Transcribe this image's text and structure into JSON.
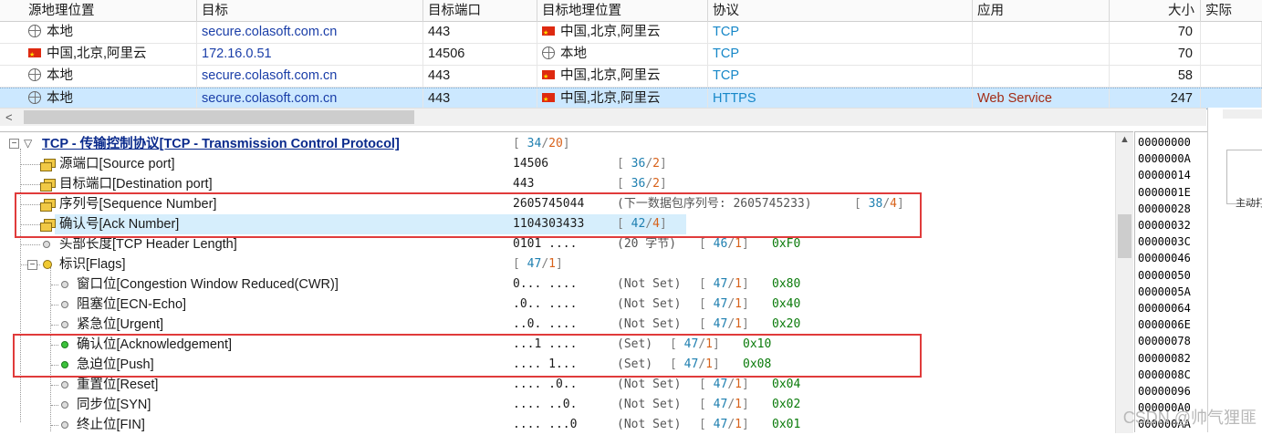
{
  "columns": [
    "源地理位置",
    "目标",
    "目标端口",
    "目标地理位置",
    "协议",
    "应用",
    "大小",
    "实际"
  ],
  "rows": [
    {
      "src_icon": "globe-icon",
      "src": "本地",
      "dst": "secure.colasoft.com.cn",
      "port": "443",
      "dgeo_icon": "china-flag-icon",
      "dgeo": "中国,北京,阿里云",
      "proto": "TCP",
      "app": "",
      "size": "70",
      "selected": false
    },
    {
      "src_icon": "china-flag-icon",
      "src": "中国,北京,阿里云",
      "dst": "172.16.0.51",
      "port": "14506",
      "dgeo_icon": "globe-icon",
      "dgeo": "本地",
      "proto": "TCP",
      "app": "",
      "size": "70",
      "selected": false
    },
    {
      "src_icon": "globe-icon",
      "src": "本地",
      "dst": "secure.colasoft.com.cn",
      "port": "443",
      "dgeo_icon": "china-flag-icon",
      "dgeo": "中国,北京,阿里云",
      "proto": "TCP",
      "app": "",
      "size": "58",
      "selected": false
    },
    {
      "src_icon": "globe-icon",
      "src": "本地",
      "dst": "secure.colasoft.com.cn",
      "port": "443",
      "dgeo_icon": "china-flag-icon",
      "dgeo": "中国,北京,阿里云",
      "proto": "HTTPS",
      "app": "Web Service",
      "size": "247",
      "selected": true
    }
  ],
  "scroll_left_arrow": "<",
  "tree": {
    "root": {
      "label": "TCP - 传输控制协议[TCP - Transmission Control Protocol]",
      "o1": "34",
      "o2": "20"
    },
    "lines": [
      {
        "key": "src-port",
        "label": "源端口[Source port]",
        "value": "14506",
        "note": "",
        "o1": "36",
        "o2": "2",
        "hex": "",
        "pre": "[ ",
        "mid": "/",
        "post": "]",
        "icon": "field"
      },
      {
        "key": "dst-port",
        "label": "目标端口[Destination port]",
        "value": "443",
        "note": "",
        "o1": "36",
        "o2": "2",
        "hex": "",
        "icon": "field"
      },
      {
        "key": "seq",
        "label": "序列号[Sequence Number]",
        "value": "2605745044",
        "note": "(下一数据包序列号: 2605745233)",
        "o1": "38",
        "o2": "4",
        "hex": "",
        "icon": "field"
      },
      {
        "key": "ack",
        "label": "确认号[Ack Number]",
        "value": "1104303433",
        "note": "",
        "o1": "42",
        "o2": "4",
        "hex": "",
        "icon": "field"
      },
      {
        "key": "hdr-len",
        "label": "头部长度[TCP Header Length]",
        "value": "0101 ....",
        "note": "(20 字节)",
        "o1": "46",
        "o2": "1",
        "hex": "0xF0",
        "icon": "dot"
      },
      {
        "key": "flags",
        "label": "标识[Flags]",
        "value": "",
        "note": "",
        "o1": "47",
        "o2": "1",
        "hex": "",
        "icon": "flags"
      },
      {
        "key": "cwr",
        "label": "窗口位[Congestion Window Reduced(CWR)]",
        "value": "0... ....",
        "note": "(Not Set)",
        "o1": "47",
        "o2": "1",
        "hex": "0x80",
        "icon": "dot"
      },
      {
        "key": "ece",
        "label": "阻塞位[ECN-Echo]",
        "value": ".0.. ....",
        "note": "(Not Set)",
        "o1": "47",
        "o2": "1",
        "hex": "0x40",
        "icon": "dot"
      },
      {
        "key": "urg",
        "label": "紧急位[Urgent]",
        "value": "..0. ....",
        "note": "(Not Set)",
        "o1": "47",
        "o2": "1",
        "hex": "0x20",
        "icon": "dot"
      },
      {
        "key": "ackf",
        "label": "确认位[Acknowledgement]",
        "value": "...1 ....",
        "note": "(Set)",
        "o1": "47",
        "o2": "1",
        "hex": "0x10",
        "icon": "green"
      },
      {
        "key": "psh",
        "label": "急迫位[Push]",
        "value": ".... 1...",
        "note": "(Set)",
        "o1": "47",
        "o2": "1",
        "hex": "0x08",
        "icon": "green"
      },
      {
        "key": "rst",
        "label": "重置位[Reset]",
        "value": ".... .0..",
        "note": "(Not Set)",
        "o1": "47",
        "o2": "1",
        "hex": "0x04",
        "icon": "dot"
      },
      {
        "key": "syn",
        "label": "同步位[SYN]",
        "value": ".... ..0.",
        "note": "(Not Set)",
        "o1": "47",
        "o2": "1",
        "hex": "0x02",
        "icon": "dot"
      },
      {
        "key": "fin",
        "label": "终止位[FIN]",
        "value": ".... ...0",
        "note": "(Not Set)",
        "o1": "47",
        "o2": "1",
        "hex": "0x01",
        "icon": "dot"
      }
    ]
  },
  "hex_offsets": [
    "00000000",
    "0000000A",
    "00000014",
    "0000001E",
    "00000028",
    "00000032",
    "0000003C",
    "00000046",
    "00000050",
    "0000005A",
    "00000064",
    "0000006E",
    "00000078",
    "00000082",
    "0000008C",
    "00000096",
    "000000A0",
    "000000AA"
  ],
  "right_panel_label": "主动打",
  "watermark": "CSDN @帅气狸匪"
}
